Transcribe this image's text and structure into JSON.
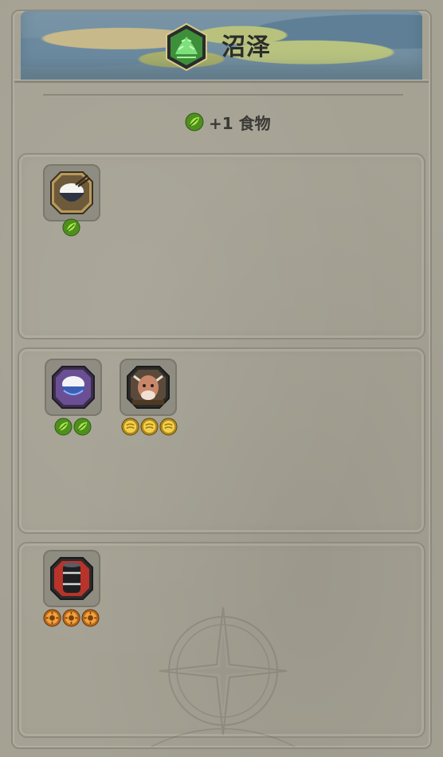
{
  "terrain": {
    "name": "沼泽",
    "icon": "swamp-terrain-icon",
    "yield_text": "+1 食物",
    "yield_icon": "food-leaf-icon"
  },
  "sections": [
    {
      "items": [
        {
          "name": "rice-bowl-icon",
          "cost_icon": "food-leaf-icon",
          "cost_count": 1
        }
      ]
    },
    {
      "items": [
        {
          "name": "purple-rice-bowl-icon",
          "cost_icon": "food-leaf-icon",
          "cost_count": 2
        },
        {
          "name": "cow-icon",
          "cost_icon": "gold-coin-icon",
          "cost_count": 3
        }
      ]
    },
    {
      "items": [
        {
          "name": "oil-barrel-icon",
          "cost_icon": "orange-gear-coin-icon",
          "cost_count": 3
        }
      ]
    }
  ],
  "colors": {
    "panel": "#a5a294",
    "border": "#8f8c80",
    "food": "#6fbf2a",
    "gold": "#d9b232",
    "orange": "#e69a3a"
  }
}
